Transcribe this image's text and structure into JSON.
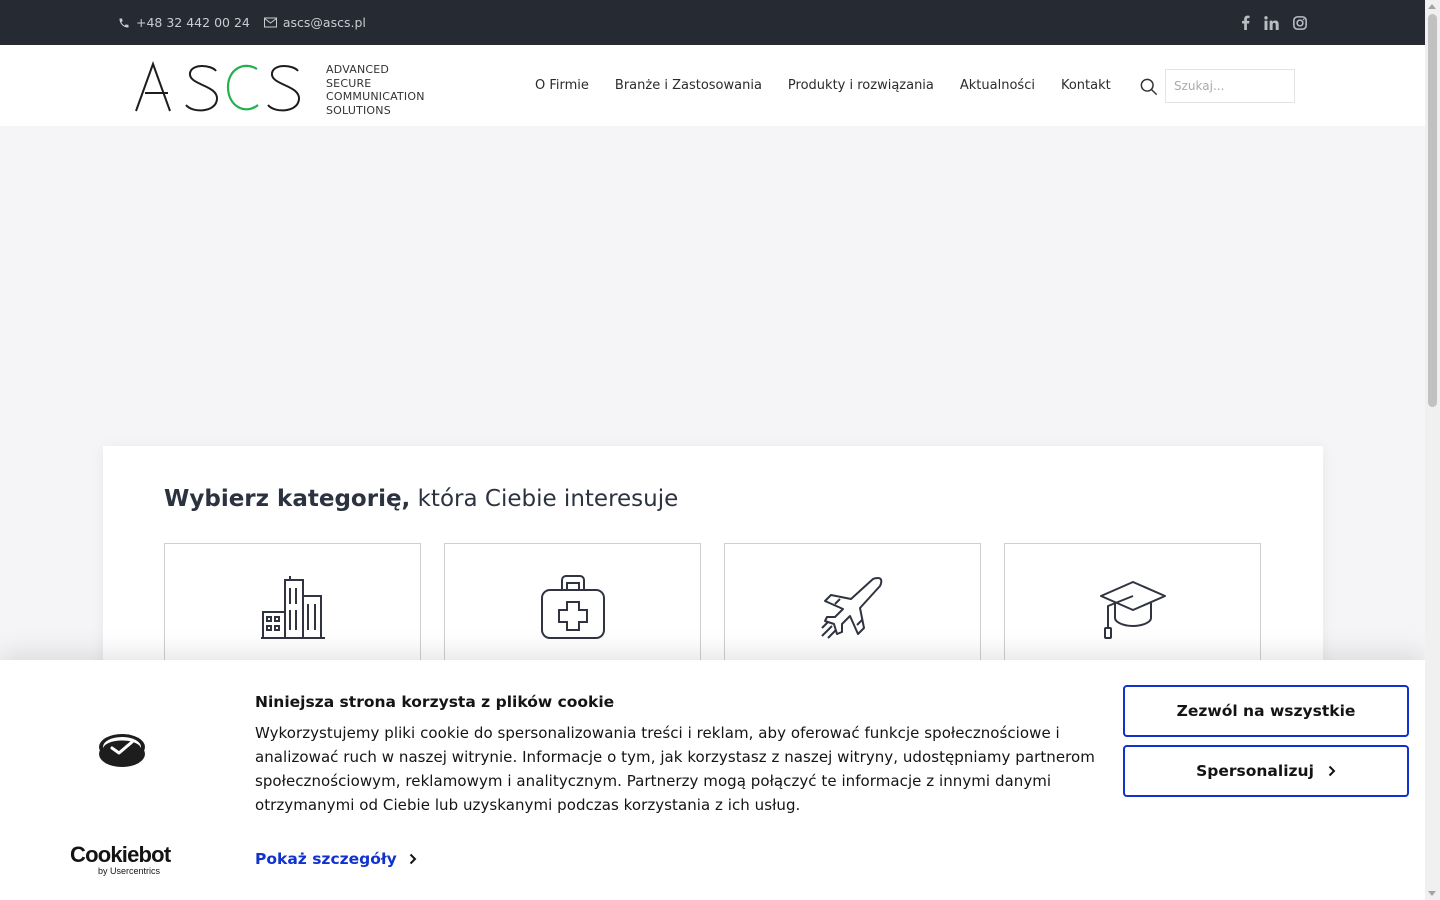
{
  "topbar": {
    "phone": "+48 32 442 00 24",
    "email": "ascs@ascs.pl",
    "social_icons": [
      "facebook-icon",
      "linkedin-icon",
      "instagram-icon"
    ]
  },
  "header": {
    "logo_text": "ASCS",
    "logo_tagline": [
      "ADVANCED",
      "SECURE",
      "COMMUNICATION",
      "SOLUTIONS"
    ],
    "nav": [
      {
        "label": "O Firmie"
      },
      {
        "label": "Branże i Zastosowania"
      },
      {
        "label": "Produkty i rozwiązania"
      },
      {
        "label": "Aktualności"
      },
      {
        "label": "Kontakt"
      }
    ],
    "search_placeholder": "Szukaj..."
  },
  "categories": {
    "title_bold": "Wybierz kategorię,",
    "title_rest": " która Ciebie interesuje",
    "tiles": [
      {
        "icon": "buildings-icon"
      },
      {
        "icon": "medical-kit-icon"
      },
      {
        "icon": "airplane-icon"
      },
      {
        "icon": "graduation-cap-icon"
      }
    ]
  },
  "cookie_banner": {
    "title": "Niniejsza strona korzysta z plików cookie",
    "body": "Wykorzystujemy pliki cookie do spersonalizowania treści i reklam, aby oferować funkcje społecznościowe i analizować ruch w naszej witrynie. Informacje o tym, jak korzystasz z naszej witryny, udostępniamy partnerom społecznościowym, reklamowym i analitycznym. Partnerzy mogą połączyć te informacje z innymi danymi otrzymanymi od Ciebie lub uzyskanymi podczas korzystania z ich usług.",
    "details_link": "Pokaż szczegóły",
    "allow_all": "Zezwól na wszystkie",
    "customize": "Spersonalizuj",
    "brand_name": "Cookiebot",
    "brand_by": "by Usercentrics"
  },
  "colors": {
    "topbar_bg": "#262a33",
    "accent_green": "#22b14c",
    "cookie_blue": "#1032cf"
  }
}
